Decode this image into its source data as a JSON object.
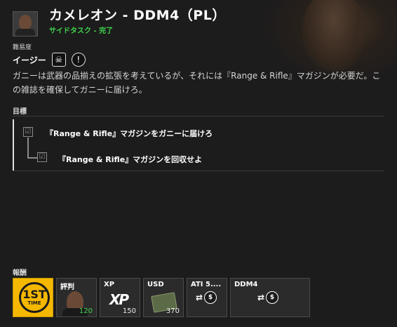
{
  "mission": {
    "title": "カメレオン - DDM4（PL）",
    "subtitle": "サイドタスク - 完了",
    "difficulty_label": "難易度",
    "difficulty_value": "イージー",
    "description": "ガニーは武器の品揃えの拡張を考えているが、それには『Range & Rifle』マガジンが必要だ。この雑誌を確保してガニーに届けろ。"
  },
  "objectives": {
    "heading": "目標",
    "items": [
      {
        "text": "『Range & Rifle』マガジンをガニーに届けろ",
        "done": true
      },
      {
        "text": "『Range & Rifle』マガジンを回収せよ",
        "done": true
      }
    ]
  },
  "rewards": {
    "heading": "報酬",
    "items": [
      {
        "label": "",
        "badge_big": "1ST",
        "badge_small": "TIME",
        "count": ""
      },
      {
        "label": "評判",
        "count": "120"
      },
      {
        "label": "XP",
        "glyph": "XP",
        "count": "150"
      },
      {
        "label": "USD",
        "count": "370"
      },
      {
        "label": "ATI 5....",
        "count": ""
      },
      {
        "label": "DDM4",
        "count": ""
      }
    ]
  },
  "icons": {
    "checkbox": "☑",
    "skull": "☠",
    "alert": "!",
    "coin": "$",
    "arrow": "⇄"
  },
  "colors": {
    "accent_green": "#3fd54b",
    "gold": "#f5b800"
  }
}
